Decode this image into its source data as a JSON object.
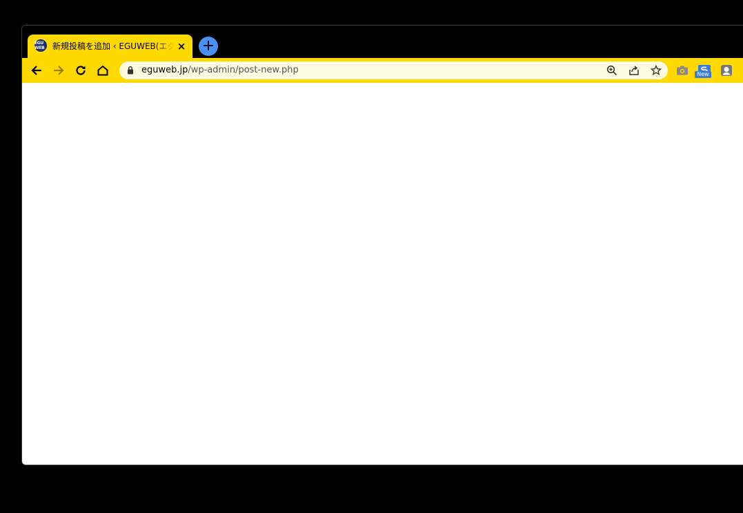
{
  "tab": {
    "title": "新規投稿を追加 ‹ EGUWEB(エグウェブ) — WordPress",
    "favicon_text": "EGU WEB",
    "close_label": "×"
  },
  "newtab_label": "+",
  "address_bar": {
    "host": "eguweb.jp",
    "path": "/wp-admin/post-new.php"
  },
  "extensions": {
    "new_badge": "New"
  },
  "colors": {
    "theme": "#ffd900",
    "omnibox": "#fffae0",
    "newtab": "#4a90f0"
  }
}
